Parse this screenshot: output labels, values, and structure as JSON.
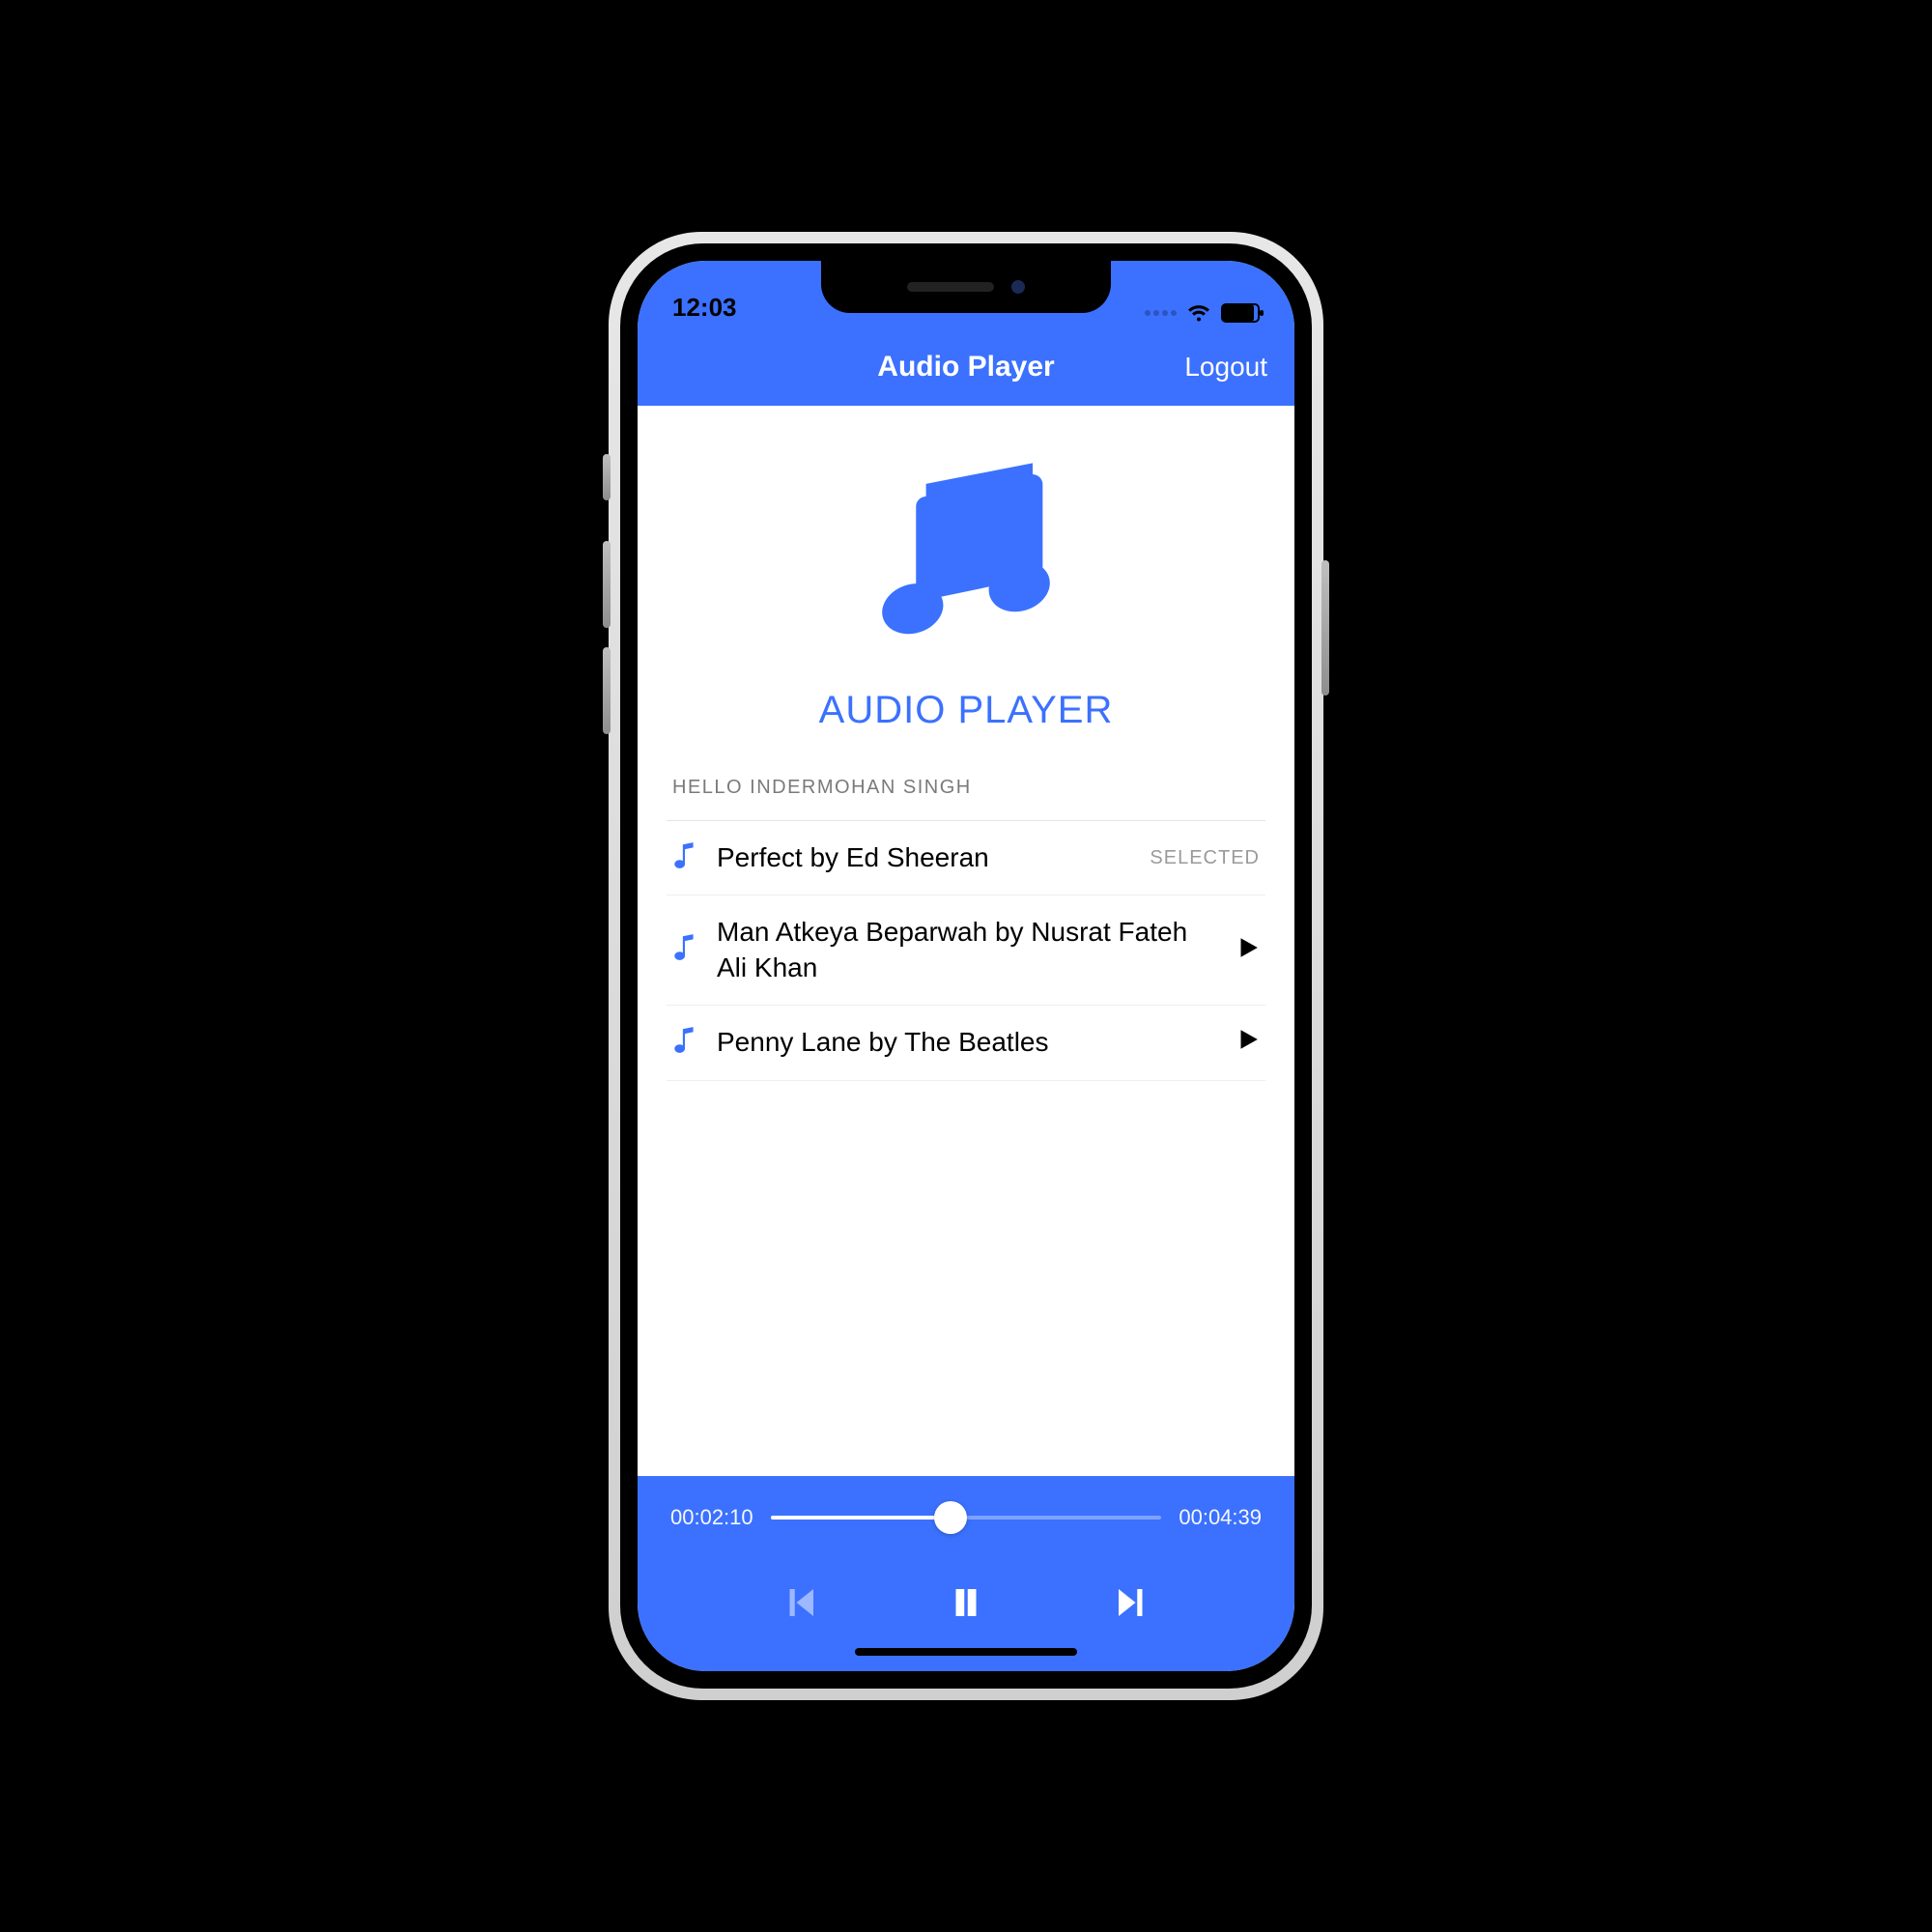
{
  "colors": {
    "accent": "#3b71fe"
  },
  "status": {
    "time": "12:03"
  },
  "navbar": {
    "title": "Audio Player",
    "logout_label": "Logout"
  },
  "hero": {
    "title": "AUDIO PLAYER"
  },
  "list": {
    "greeting": "HELLO INDERMOHAN SINGH",
    "selected_label": "SELECTED",
    "tracks": [
      {
        "title": "Perfect by Ed Sheeran",
        "selected": true
      },
      {
        "title": "Man Atkeya Beparwah by Nusrat Fateh Ali Khan",
        "selected": false
      },
      {
        "title": "Penny Lane by The Beatles",
        "selected": false
      }
    ]
  },
  "player": {
    "elapsed": "00:02:10",
    "duration": "00:04:39",
    "progress_pct": 46
  }
}
